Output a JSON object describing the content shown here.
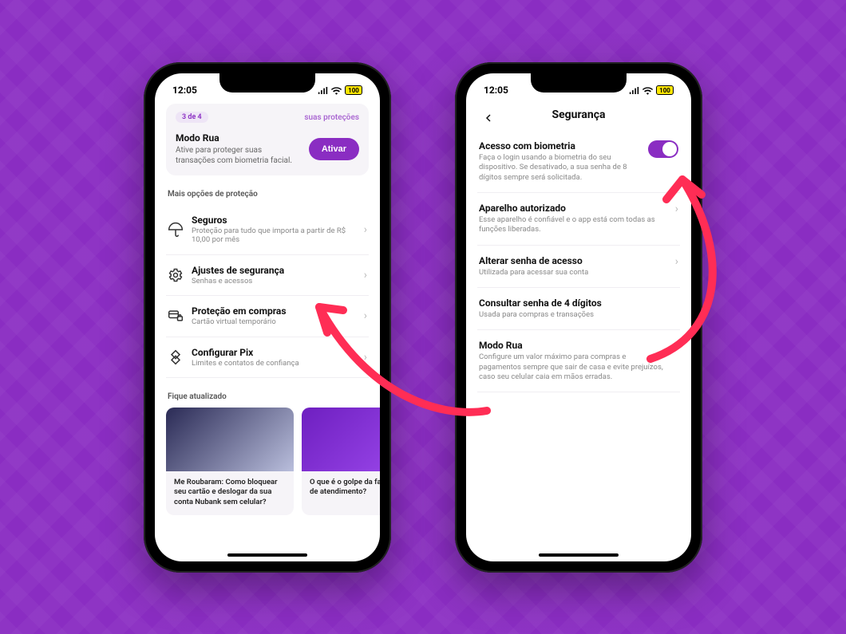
{
  "status": {
    "time": "12:05",
    "battery": "100"
  },
  "left": {
    "step": "3 de 4",
    "topcard_subtitle": "suas proteções",
    "modo_rua_title": "Modo Rua",
    "modo_rua_desc": "Ative para proteger suas transações com biometria facial.",
    "ativar": "Ativar",
    "section_more": "Mais opções de proteção",
    "options": [
      {
        "title": "Seguros",
        "sub": "Proteção para tudo que importa a partir de R$ 10,00 por mês"
      },
      {
        "title": "Ajustes de segurança",
        "sub": "Senhas e acessos"
      },
      {
        "title": "Proteção em compras",
        "sub": "Cartão virtual temporário"
      },
      {
        "title": "Configurar Pix",
        "sub": "Limites e contatos de confiança"
      }
    ],
    "section_news": "Fique atualizado",
    "news": [
      {
        "title": "Me Roubaram: Como bloquear seu cartão e deslogar da sua conta Nubank sem celular?"
      },
      {
        "title": "O que é o golpe da falsa central de atendimento?"
      }
    ]
  },
  "right": {
    "title": "Segurança",
    "items": [
      {
        "title": "Acesso com biometria",
        "desc": "Faça o login usando a biometria do seu dispositivo. Se desativado, a sua senha de 8 dígitos sempre será solicitada.",
        "type": "toggle"
      },
      {
        "title": "Aparelho autorizado",
        "desc": "Esse aparelho é confiável e o app está com todas as funções liberadas.",
        "type": "chevron"
      },
      {
        "title": "Alterar senha de acesso",
        "desc": "Utilizada para acessar sua conta",
        "type": "chevron"
      },
      {
        "title": "Consultar senha de 4 dígitos",
        "desc": "Usada para compras e transações",
        "type": "none"
      },
      {
        "title": "Modo Rua",
        "desc": "Configure um valor máximo para compras e pagamentos sempre que sair de casa e evite prejuízos, caso seu celular caia em mãos erradas.",
        "type": "chevron"
      }
    ]
  }
}
